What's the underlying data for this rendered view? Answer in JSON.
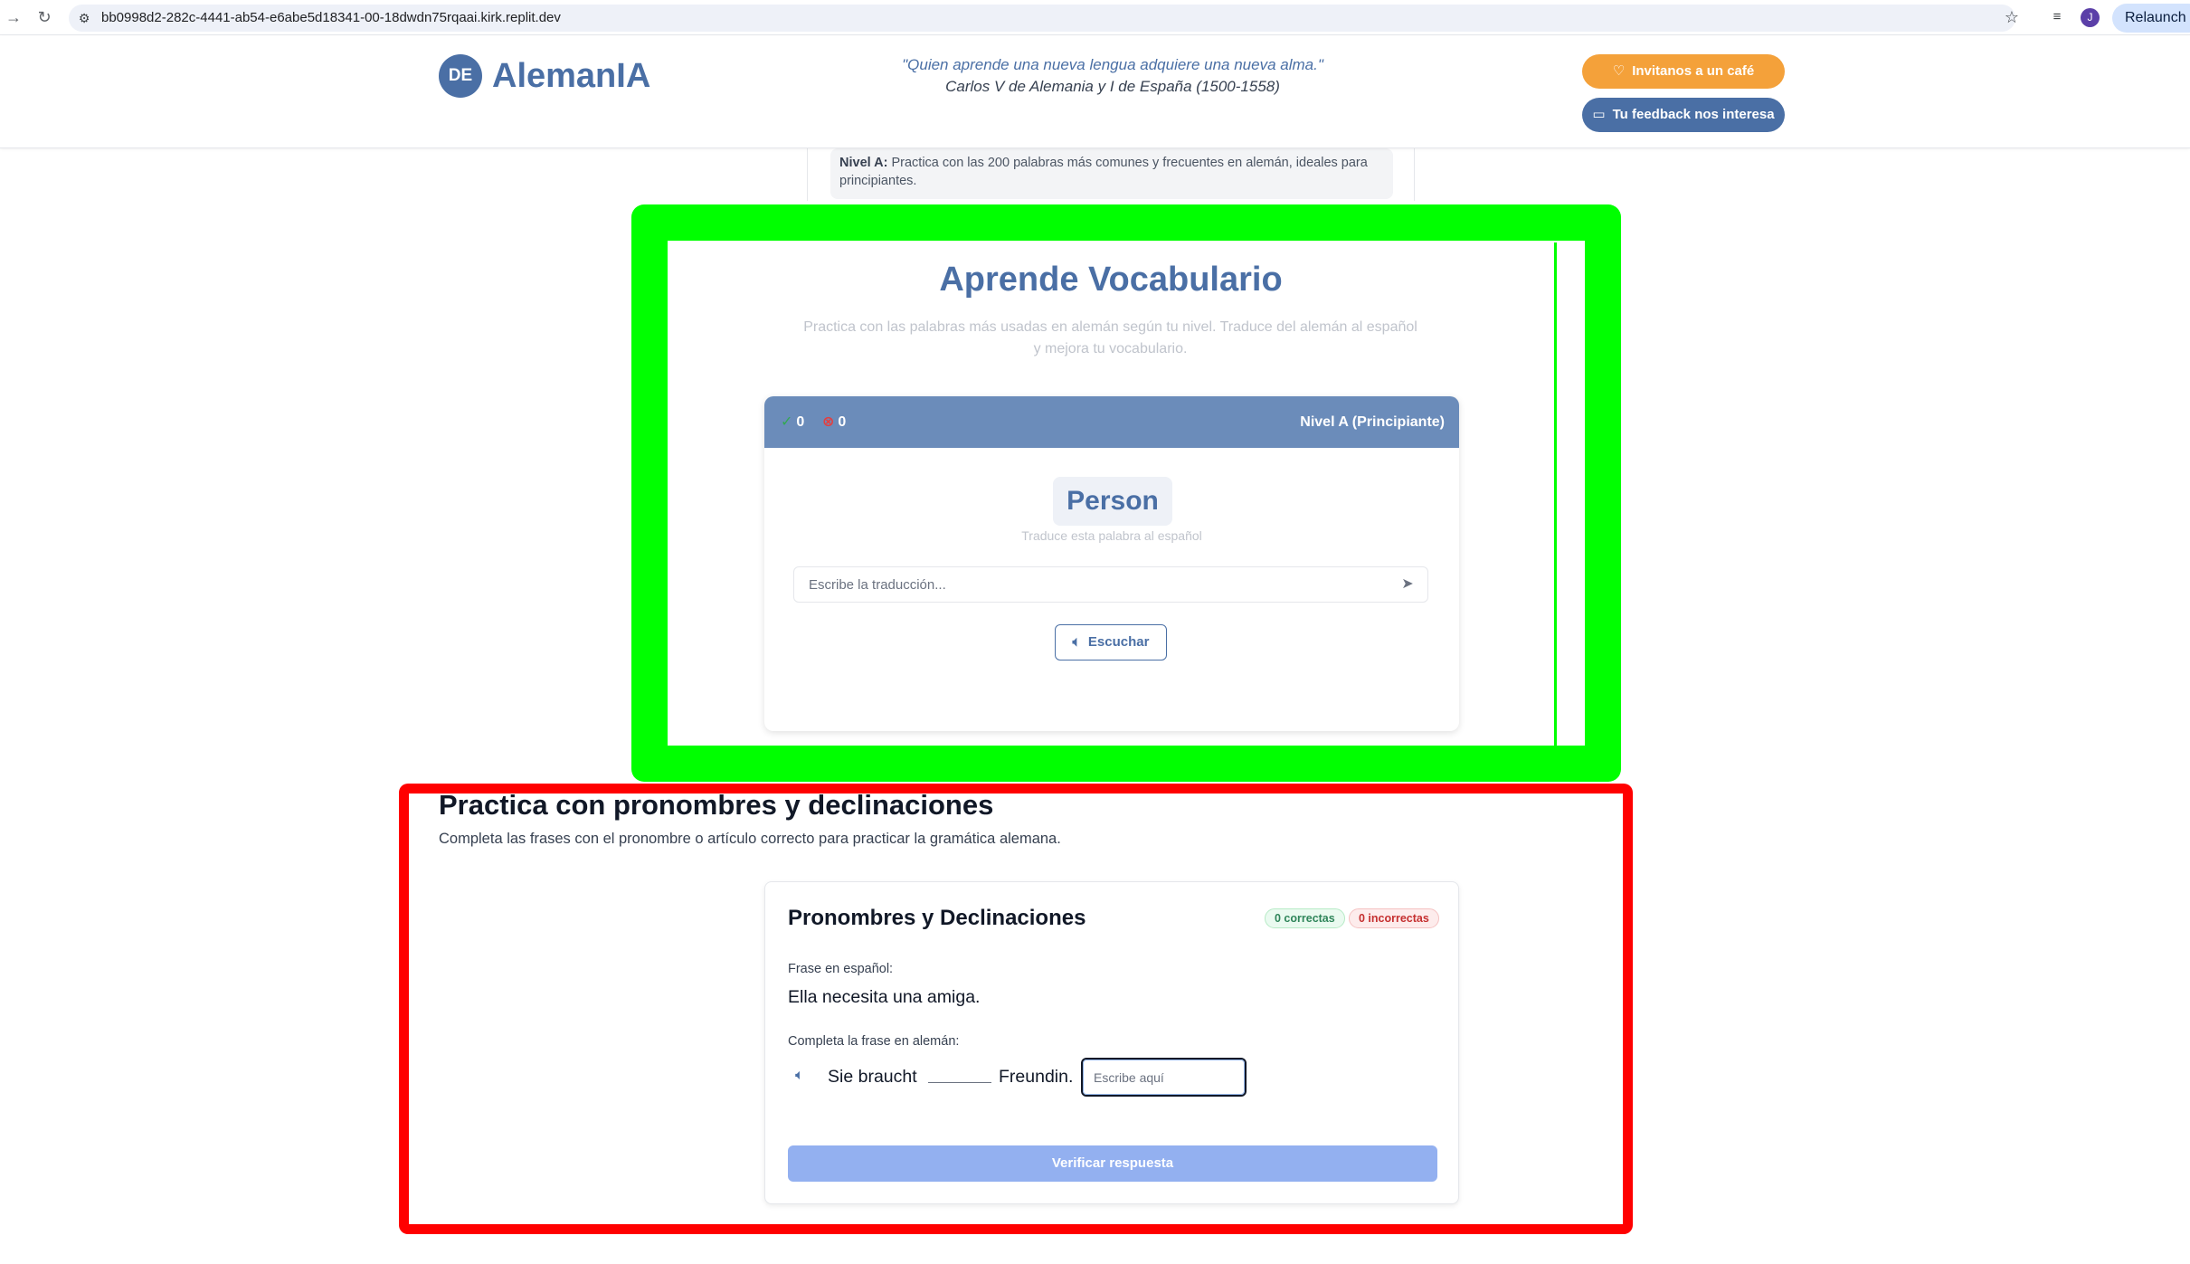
{
  "browser": {
    "url": "bb0998d2-282c-4441-ab54-e6abe5d18341-00-18dwdn75rqaai.kirk.replit.dev",
    "profile_initial": "J",
    "relaunch_label": "Relaunch t"
  },
  "header": {
    "logo_badge": "DE",
    "logo_text": "AlemanIA",
    "quote": "\"Quien aprende una nueva lengua adquiere una nueva alma.\"",
    "quote_author": "Carlos V de Alemania y I de España (1500-1558)",
    "coffee_label": "Invitanos a un café",
    "feedback_label": "Tu feedback nos interesa"
  },
  "level_note": {
    "label": "Nivel A:",
    "text": "Practica con las 200 palabras más comunes y frecuentes en alemán, ideales para principiantes."
  },
  "vocab": {
    "title": "Aprende Vocabulario",
    "subtitle": "Practica con las palabras más usadas en alemán según tu nivel. Traduce del alemán al español y mejora tu vocabulario.",
    "correct_count": "0",
    "incorrect_count": "0",
    "level": "Nivel A (Principiante)",
    "word": "Person",
    "hint": "Traduce esta palabra al español",
    "input_placeholder": "Escribe la traducción...",
    "listen_label": "Escuchar"
  },
  "pronouns": {
    "section_title": "Practica con pronombres y declinaciones",
    "section_subtitle": "Completa las frases con el pronombre o artículo correcto para practicar la gramática alemana.",
    "card_title": "Pronombres y Declinaciones",
    "badge_correct": "0 correctas",
    "badge_incorrect": "0 incorrectas",
    "es_label": "Frase en español:",
    "es_sentence": "Ella necesita una amiga.",
    "de_label": "Completa la frase en alemán:",
    "de_part1": "Sie braucht",
    "de_part2": "Freundin.",
    "answer_placeholder": "Escribe aquí",
    "verify_label": "Verificar respuesta"
  },
  "colors": {
    "brand": "#4a6fa5",
    "coffee": "#f4a13a",
    "highlight_green": "#00ff00",
    "highlight_red": "#ff0000",
    "verify_button": "#93b0f0"
  }
}
